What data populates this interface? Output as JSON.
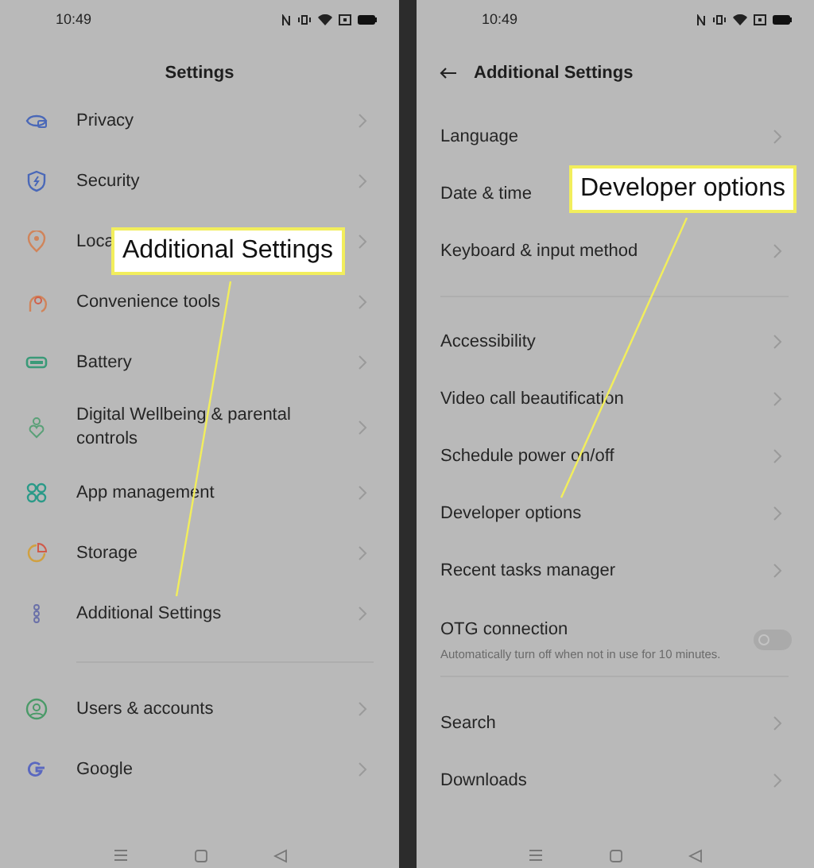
{
  "screens": [
    {
      "status_bar": {
        "time": "10:49"
      },
      "back": false,
      "title": "Settings",
      "groups": [
        [
          {
            "kind": "link",
            "label": "Privacy"
          },
          {
            "kind": "link",
            "label": "Security"
          },
          {
            "kind": "link",
            "label": "Loca"
          },
          {
            "kind": "link",
            "label": "Convenience tools"
          },
          {
            "kind": "link",
            "label": "Battery"
          },
          {
            "kind": "link",
            "label": "Digital Wellbeing & parental controls"
          },
          {
            "kind": "link",
            "label": "App management"
          },
          {
            "kind": "link",
            "label": "Storage"
          },
          {
            "kind": "link",
            "label": "Additional Settings"
          }
        ],
        [
          {
            "kind": "link",
            "label": "Users & accounts"
          },
          {
            "kind": "link",
            "label": "Google"
          }
        ]
      ]
    },
    {
      "status_bar": {
        "time": "10:49"
      },
      "back": true,
      "title": "Additional Settings",
      "groups": [
        [
          {
            "kind": "link",
            "label": "Language"
          },
          {
            "kind": "link",
            "label": "Date & time",
            "chevron": false
          },
          {
            "kind": "link",
            "label": "Keyboard & input method"
          }
        ],
        [
          {
            "kind": "link",
            "label": "Accessibility"
          },
          {
            "kind": "link",
            "label": "Video call beautification"
          },
          {
            "kind": "link",
            "label": "Schedule power on/off"
          },
          {
            "kind": "link",
            "label": "Developer options"
          },
          {
            "kind": "link",
            "label": "Recent tasks manager"
          },
          {
            "kind": "toggle",
            "label": "OTG connection",
            "subtitle": "Automatically turn off when not in use for 10 minutes.",
            "on": false
          }
        ],
        [
          {
            "kind": "link",
            "label": "Search"
          },
          {
            "kind": "link",
            "label": "Downloads"
          }
        ]
      ]
    }
  ],
  "callouts": [
    {
      "text": "Additional Settings"
    },
    {
      "text": "Developer options"
    }
  ]
}
